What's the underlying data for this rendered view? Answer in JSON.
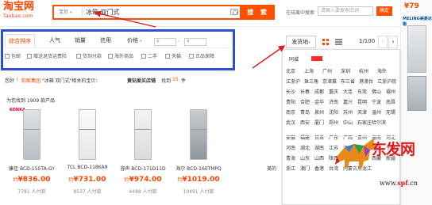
{
  "header": {
    "logo_cn": "淘宝网",
    "logo_en": "Taobao.com",
    "search_scope": "宝贝",
    "search_query": "冰箱 双门式",
    "search_button": "搜 索",
    "within_label": "在结果中搜索",
    "within_placeholder": "请输入要搜索的词",
    "within_button": "确定"
  },
  "side_ad": {
    "price": "¥79",
    "brand": "MELING美菱冰箱"
  },
  "sort_tabs": [
    {
      "label": "综合排序",
      "active": true
    },
    {
      "label": "人气",
      "active": false
    },
    {
      "label": "销量",
      "active": false
    },
    {
      "label": "信用",
      "active": false
    },
    {
      "label": "价格",
      "active": false
    }
  ],
  "price_filter": {
    "min_placeholder": "¥",
    "max_placeholder": "¥"
  },
  "checkboxes": [
    "包邮",
    "赠送退货运费险",
    "货到付款",
    "海外商品",
    "二手",
    "天猫",
    "正品保障"
  ],
  "view_controls": {
    "ship_from": "发货地",
    "pager": "1/100",
    "prev": "‹",
    "next": "›"
  },
  "location_dropdown": {
    "head": "同城",
    "cities": [
      "北京",
      "上海",
      "广州",
      "深圳",
      "杭州",
      "海外",
      "江浙沪",
      "珠三角",
      "京津冀",
      "东三省",
      "港澳台",
      "江浙沪皖",
      "长沙",
      "长春",
      "成都",
      "重庆",
      "大连",
      "东莞",
      "佛山",
      "福州",
      "贵阳",
      "合肥",
      "金华",
      "济南",
      "嘉兴",
      "昆明",
      "宁波",
      "南昌",
      "南京",
      "青岛",
      "泉州",
      "沈阳",
      "苏州",
      "天津",
      "温州",
      "无锡",
      "武汉",
      "西安",
      "厦门",
      "郑州",
      "中山",
      "石家庄",
      "哈尔滨",
      "安徽",
      "福建",
      "甘肃",
      "广东",
      "广西",
      "贵州",
      "海南",
      "河北",
      "河南",
      "湖北",
      "湖南",
      "江苏",
      "江西",
      "吉林",
      "辽宁",
      "宁夏",
      "青海",
      "山东",
      "山西",
      "陕西",
      "云南",
      "四川",
      "西藏",
      "新疆",
      "浙江",
      "澳门",
      "香港",
      "台湾",
      "内蒙古",
      "黑龙江"
    ]
  },
  "results_notice": {
    "prefix": "您好",
    "brand_prefix": "Ⅰ",
    "brand": "韵家集团",
    "mid": "\"冰箱 双门式\"相关的宝贝：",
    "shop": "黄钻爱买店铺",
    "found": "找到",
    "count": "15",
    "unit": "件"
  },
  "found_line": "为您找到 1909 款产品",
  "products": [
    {
      "brand_tag": "KONKA",
      "name": "康佳 BCD-155TA-GY",
      "price_prefix": "约",
      "price": "¥836.00",
      "sales": "7781 人付款"
    },
    {
      "brand_tag": "",
      "name": "TCL BCD-118KA9",
      "price_prefix": "约",
      "price": "¥731.00",
      "sales": "8537 人付款"
    },
    {
      "brand_tag": "",
      "name": "容声 BCD-171D11D",
      "price_prefix": "约",
      "price": "¥974.00",
      "sales": "4488 人付款"
    },
    {
      "brand_tag": "",
      "name": "海尔 BCD-160TMPQ",
      "price_prefix": "约",
      "price": "¥1019.00",
      "sales": "10491 人付款"
    },
    {
      "brand_tag": "",
      "name": "美的",
      "price_prefix": "",
      "price": "",
      "sales": ""
    }
  ],
  "watermark": {
    "title": "东发网",
    "url_w": "www.",
    "url_r": "spf",
    "url_tail": ".cn"
  },
  "colors": {
    "accent": "#ff5000",
    "highlight_box": "#2e4fd4",
    "arrow": "#e01a1a"
  }
}
